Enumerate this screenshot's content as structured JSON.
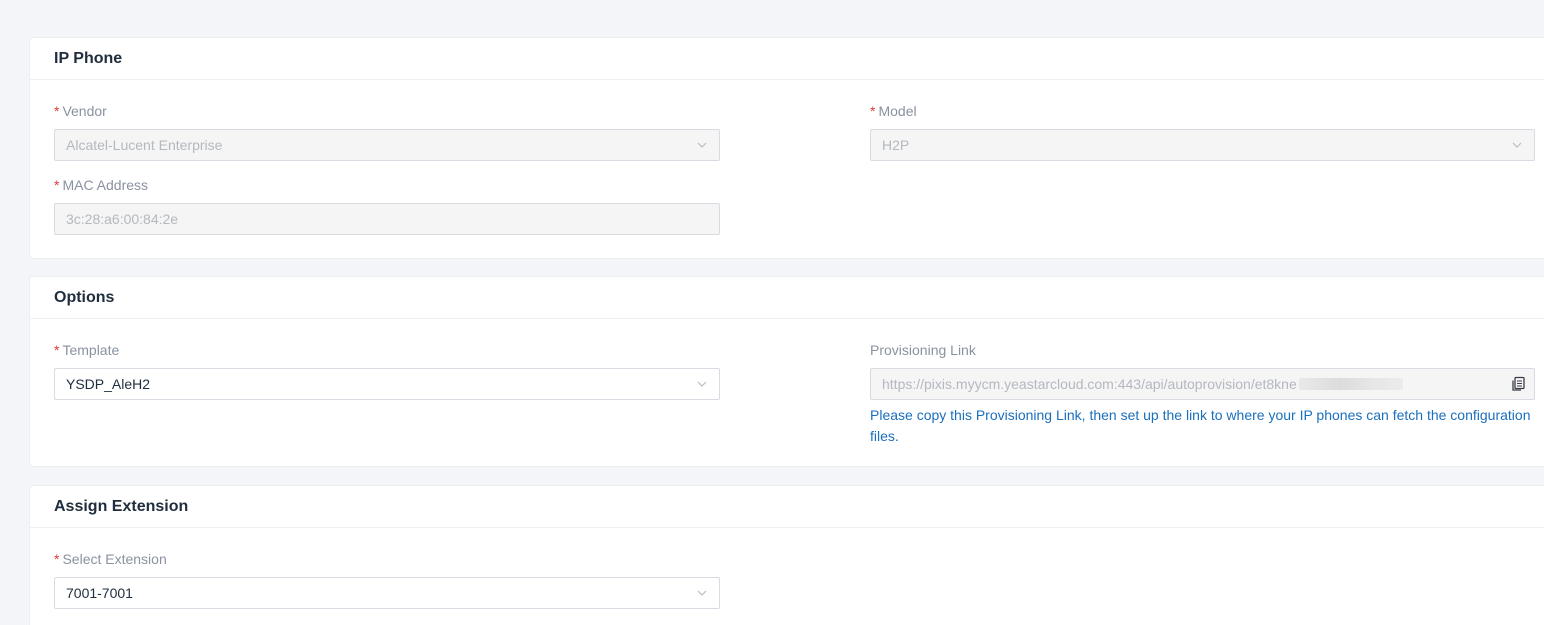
{
  "ip_phone": {
    "title": "IP Phone",
    "vendor": {
      "label": "Vendor",
      "value": "Alcatel-Lucent Enterprise"
    },
    "model": {
      "label": "Model",
      "value": "H2P"
    },
    "mac": {
      "label": "MAC Address",
      "value": "3c:28:a6:00:84:2e"
    }
  },
  "options": {
    "title": "Options",
    "template": {
      "label": "Template",
      "value": "YSDP_AleH2"
    },
    "provisioning": {
      "label": "Provisioning Link",
      "value": "https://pixis.myycm.yeastarcloud.com:443/api/autoprovision/et8kne",
      "hint": "Please copy this Provisioning Link, then set up the link to where your IP phones can fetch the configuration files."
    }
  },
  "assign_extension": {
    "title": "Assign Extension",
    "select_extension": {
      "label": "Select Extension",
      "value": "7001-7001"
    }
  },
  "required_marker": "*",
  "colors": {
    "required": "#e23a3a",
    "hint": "#1b6fbd",
    "title": "#1f2d3d"
  }
}
